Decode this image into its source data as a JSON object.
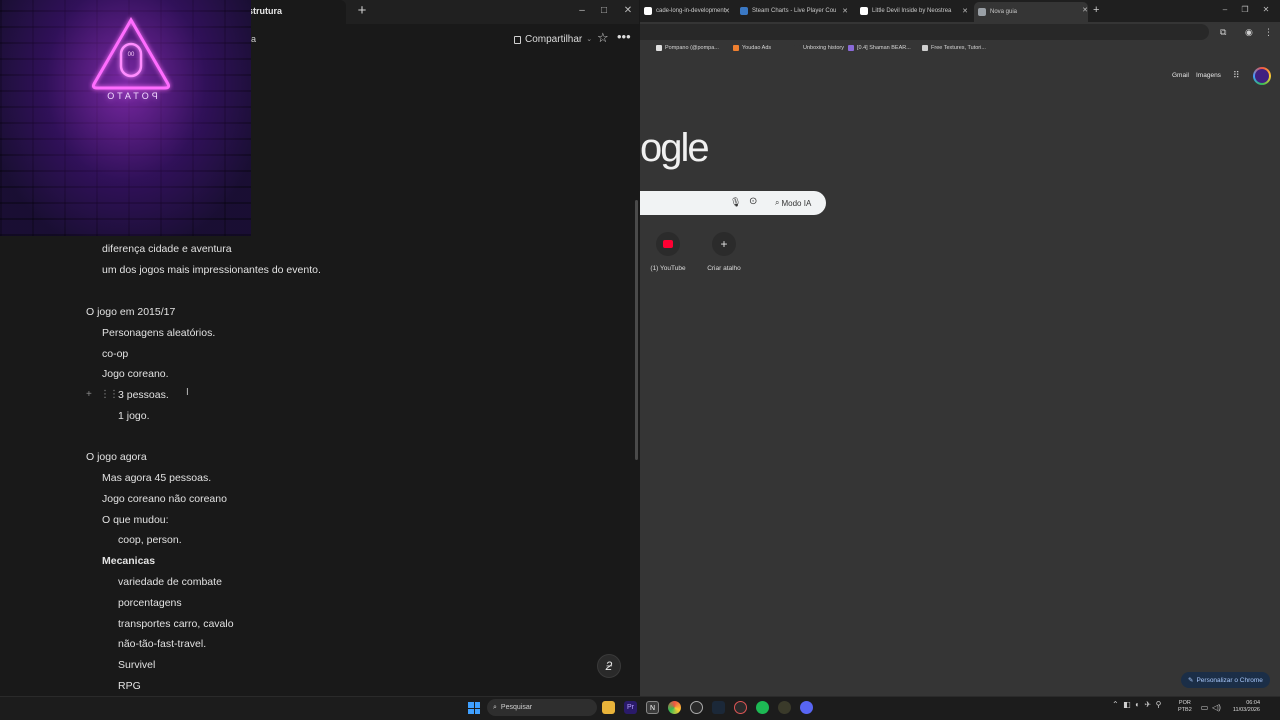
{
  "notes_app": {
    "tab_title": "strutura",
    "breadcrumb": "ra",
    "share_label": "Compartilhar",
    "lines": [
      {
        "text": "diferença cidade e aventura",
        "indent": 1,
        "bold": false
      },
      {
        "text": "um dos jogos mais impressionantes do evento.",
        "indent": 1,
        "bold": false
      },
      {
        "text": "O jogo em 2015/17",
        "indent": 0,
        "bold": false
      },
      {
        "text": "Personagens aleatórios.",
        "indent": 1,
        "bold": false
      },
      {
        "text": "co-op",
        "indent": 1,
        "bold": false
      },
      {
        "text": "Jogo coreano.",
        "indent": 1,
        "bold": false
      },
      {
        "text": "3 pessoas.",
        "indent": 2,
        "bold": false
      },
      {
        "text": "1 jogo.",
        "indent": 2,
        "bold": false
      },
      {
        "text": "O jogo agora",
        "indent": 0,
        "bold": false
      },
      {
        "text": "Mas agora 45 pessoas.",
        "indent": 1,
        "bold": false
      },
      {
        "text": "Jogo coreano não coreano",
        "indent": 1,
        "bold": false
      },
      {
        "text": "O que mudou:",
        "indent": 1,
        "bold": false
      },
      {
        "text": "coop, person.",
        "indent": 2,
        "bold": false
      },
      {
        "text": "Mecanicas",
        "indent": 1,
        "bold": true
      },
      {
        "text": "variedade de combate",
        "indent": 2,
        "bold": false
      },
      {
        "text": "porcentagens",
        "indent": 2,
        "bold": false
      },
      {
        "text": "transportes carro, cavalo",
        "indent": 2,
        "bold": false
      },
      {
        "text": "não-tão-fast-travel.",
        "indent": 2,
        "bold": false
      },
      {
        "text": "Survivel",
        "indent": 2,
        "bold": false
      },
      {
        "text": "RPG",
        "indent": 2,
        "bold": false
      }
    ]
  },
  "overlay": {
    "text": "POTATO"
  },
  "browser": {
    "tabs": [
      {
        "label": "cade-long-in-development",
        "color": "#ffffff",
        "active": false
      },
      {
        "label": "Steam Charts - Live Player Cou",
        "color": "#3a78c4",
        "active": false
      },
      {
        "label": "Little Devil Inside by Neostrea",
        "color": "#ffffff",
        "active": false
      },
      {
        "label": "Nova guia",
        "color": "#9aa0a6",
        "active": true
      }
    ],
    "bookmarks": [
      {
        "label": "Pompano (@pompa...",
        "color": "#e0e0e0"
      },
      {
        "label": "Youdao Ads",
        "color": "#f08030"
      },
      {
        "label": "Unboxing history",
        "color": "#353535"
      },
      {
        "label": "[0.4] Shaman BEAR...",
        "color": "#8a6ad8"
      },
      {
        "label": "Free Textures, Tutori...",
        "color": "#d0d0d0"
      }
    ],
    "gmail": "Gmail",
    "images": "Imagens",
    "logo_text": "ogle",
    "ai_mode": "Modo IA",
    "shortcuts": [
      {
        "label": "(1) YouTube"
      },
      {
        "label": "Criar atalho"
      }
    ],
    "customize": "Personalizar o Chrome"
  },
  "taskbar": {
    "search_placeholder": "Pesquisar",
    "lang_line1": "POR",
    "lang_line2": "PTB2",
    "time": "06:04",
    "date": "11/03/2026"
  }
}
